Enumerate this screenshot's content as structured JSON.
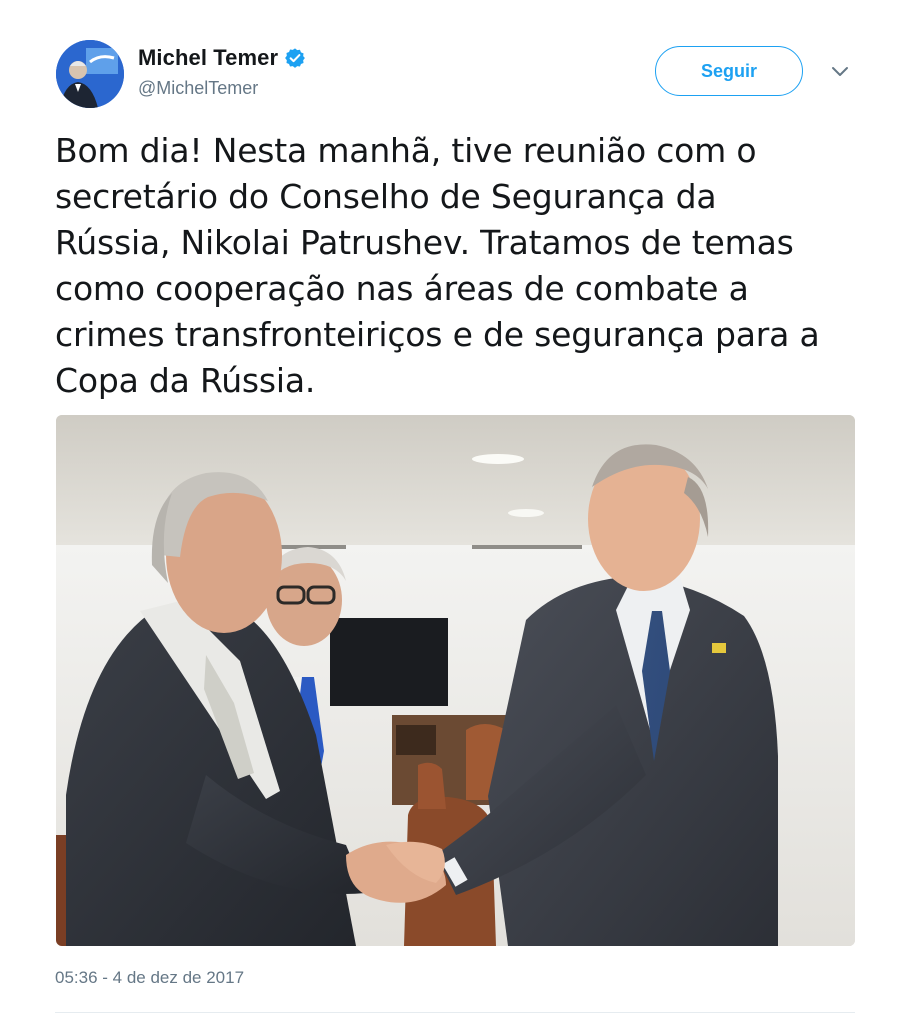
{
  "author": {
    "display_name": "Michel Temer",
    "handle": "@MichelTemer",
    "verified": true,
    "verified_icon": "verified-badge-icon",
    "avatar_icon": "avatar-photo"
  },
  "actions": {
    "follow_label": "Seguir",
    "more_icon": "chevron-down-icon"
  },
  "tweet": {
    "text": "Bom dia! Nesta manhã, tive reunião com o\nsecretário do Conselho de Segurança da\nRússia, Nikolai Patrushev. Tratamos de temas\ncomo cooperação nas áreas de combate a\ncrimes transfronteiriços e de segurança para a\nCopa da Rússia.",
    "timestamp": "05:36 - 4 de dez de 2017"
  },
  "colors": {
    "accent": "#1da1f2",
    "text": "#14171a",
    "secondary": "#657786"
  }
}
